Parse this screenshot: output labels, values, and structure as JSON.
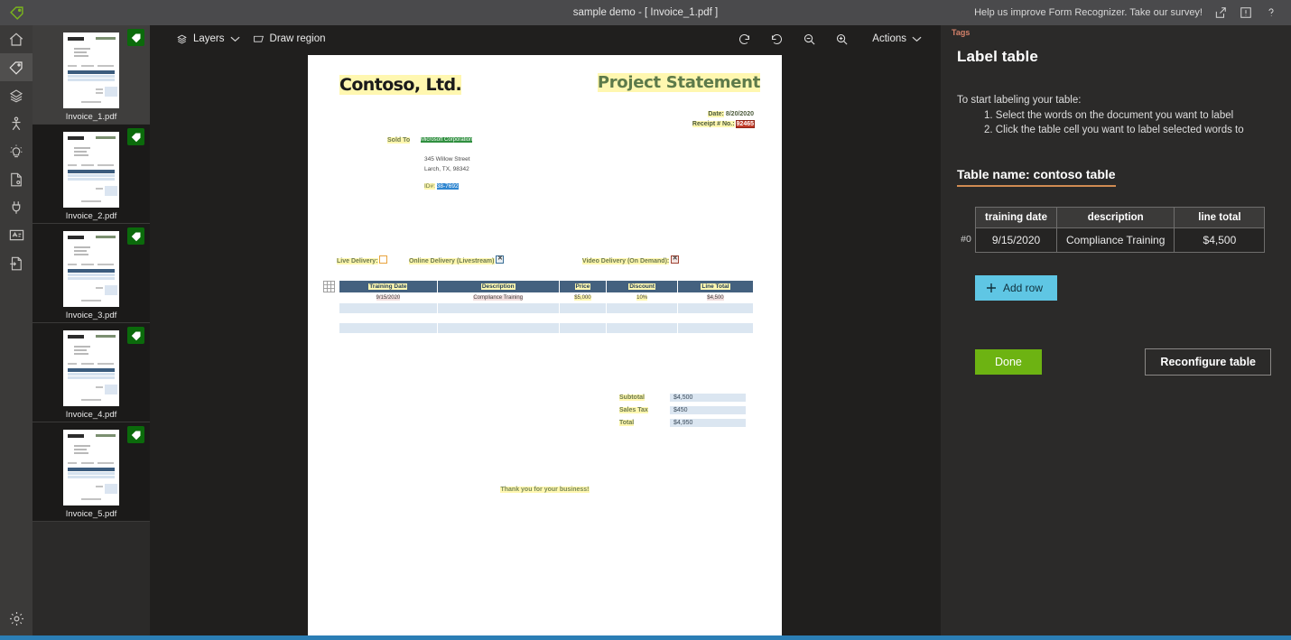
{
  "titlebar": {
    "logo_icon": "tag-logo-icon",
    "title": "sample demo - [ Invoice_1.pdf ]",
    "survey_text": "Help us improve Form Recognizer. Take our survey!",
    "share_icon": "share-icon",
    "feedback_icon": "feedback-icon",
    "help_icon": "help-question-icon"
  },
  "rail": {
    "items": [
      {
        "name": "home",
        "icon": "home-icon",
        "active": false
      },
      {
        "name": "tag-editor",
        "icon": "tag-icon",
        "active": true
      },
      {
        "name": "compose",
        "icon": "layers-image-icon",
        "active": false
      },
      {
        "name": "connections",
        "icon": "person-connect-icon",
        "active": false
      },
      {
        "name": "train",
        "icon": "lightbulb-icon",
        "active": false
      },
      {
        "name": "analyze",
        "icon": "document-gear-icon",
        "active": false
      },
      {
        "name": "model-compose",
        "icon": "plug-icon",
        "active": false
      },
      {
        "name": "prediction",
        "icon": "id-card-icon",
        "active": false
      },
      {
        "name": "export",
        "icon": "document-export-icon",
        "active": false
      }
    ],
    "settings_icon": "settings-gear-icon"
  },
  "thumbnails": [
    {
      "label": "Invoice_1.pdf",
      "selected": true,
      "badge_icon": "labeled-check-icon"
    },
    {
      "label": "Invoice_2.pdf",
      "selected": false,
      "badge_icon": "labeled-check-icon"
    },
    {
      "label": "Invoice_3.pdf",
      "selected": false,
      "badge_icon": "labeled-check-icon"
    },
    {
      "label": "Invoice_4.pdf",
      "selected": false,
      "badge_icon": "labeled-check-icon"
    },
    {
      "label": "Invoice_5.pdf",
      "selected": false,
      "badge_icon": "labeled-check-icon"
    }
  ],
  "toolbar": {
    "layers_label": "Layers",
    "layers_icon": "layers-icon",
    "layers_chevron": "chevron-down-icon",
    "draw_region_label": "Draw region",
    "draw_region_icon": "draw-region-icon",
    "rotate_ccw_icon": "rotate-counterclockwise-icon",
    "rotate_cw_icon": "rotate-clockwise-icon",
    "zoom_out_icon": "zoom-out-icon",
    "zoom_in_icon": "zoom-in-icon",
    "actions_label": "Actions",
    "actions_chevron": "chevron-down-icon"
  },
  "document": {
    "brand": "Contoso, Ltd.",
    "statement_title": "Project Statement",
    "date_label": "Date:",
    "date_value": "8/20/2020",
    "receipt_label": "Receipt # No.:",
    "receipt_value": "92465",
    "sold_to_label": "Sold To",
    "sold_to_name": "Microsoft  Corporation",
    "address_line1": "345 Willow Street",
    "address_line2": "Larch, TX, 98342",
    "id_label": "ID#:",
    "id_value": "38-7692",
    "delivery": {
      "live_label": "Live Delivery:",
      "live_checked": false,
      "online_label": "Online Delivery (Livestream)",
      "online_checked": true,
      "video_label": "Video Delivery (On Demand):",
      "video_checked": true
    },
    "table": {
      "headers": [
        "Training Date",
        "Description",
        "Price",
        "Discount",
        "Line Total"
      ],
      "rows": [
        [
          "9/15/2020",
          "Compliance Training",
          "$5,000",
          "10%",
          "$4,500"
        ]
      ],
      "blank_rows": 2
    },
    "totals": [
      {
        "label": "Subtotal",
        "value": "$4,500"
      },
      {
        "label": "Sales Tax",
        "value": "$450"
      },
      {
        "label": "Total",
        "value": "$4,950"
      }
    ],
    "footer": "Thank you for your business!"
  },
  "right_panel": {
    "section_tag": "Tags",
    "title": "Label table",
    "instructions_intro": "To start labeling your table:",
    "instruction_1": "1. Select the words on the document you want to label",
    "instruction_2": "2. Click the table cell you want to label selected words to",
    "table_name": "Table name: contoso table",
    "label_table": {
      "headers": [
        "training date",
        "description",
        "line total"
      ],
      "rows": [
        {
          "index": "#0",
          "cells": [
            "9/15/2020",
            "Compliance Training",
            "$4,500"
          ]
        }
      ]
    },
    "add_row_label": "Add row",
    "add_row_icon": "plus-icon",
    "done_label": "Done",
    "reconfigure_label": "Reconfigure table"
  },
  "colors": {
    "accent_blue": "#2b7eb5",
    "add_row": "#5fc6e4",
    "done_green": "#6db312",
    "badge_green": "#0b6a0b",
    "tag_underline": "#d08b52",
    "tags_label": "#d4816a"
  }
}
